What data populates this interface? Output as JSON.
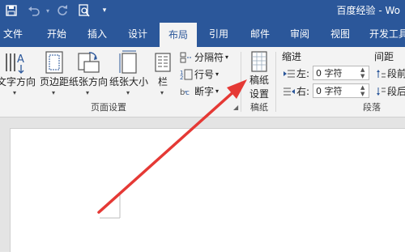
{
  "title_bar": {
    "title": "百度经验 - Wo"
  },
  "quick_access": {
    "save": "save-icon",
    "undo": "undo-icon",
    "redo": "redo-icon",
    "preview": "print-preview-icon",
    "customize": "▾"
  },
  "tabs": [
    {
      "label": "文件"
    },
    {
      "label": "开始"
    },
    {
      "label": "插入"
    },
    {
      "label": "设计"
    },
    {
      "label": "布局",
      "active": true
    },
    {
      "label": "引用"
    },
    {
      "label": "邮件"
    },
    {
      "label": "审阅"
    },
    {
      "label": "视图"
    },
    {
      "label": "开发工具"
    }
  ],
  "page_setup": {
    "text_direction": "文字方向",
    "margins": "页边距",
    "orientation": "纸张方向",
    "size": "纸张大小",
    "columns": "栏",
    "breaks": "分隔符",
    "line_numbers": "行号",
    "hyphenation": "断字",
    "group_label": "页面设置"
  },
  "manuscript": {
    "label_line1": "稿纸",
    "label_line2": "设置",
    "group_label": "稿纸"
  },
  "paragraph": {
    "indent_header": "缩进",
    "spacing_header": "间距",
    "left_label": "左:",
    "left_value": "0 字符",
    "right_label": "右:",
    "right_value": "0 字符",
    "before_label": "段前",
    "after_label": "段后",
    "group_label": "段落"
  },
  "colors": {
    "brand": "#2b579a",
    "annotation_arrow": "#e53935"
  }
}
